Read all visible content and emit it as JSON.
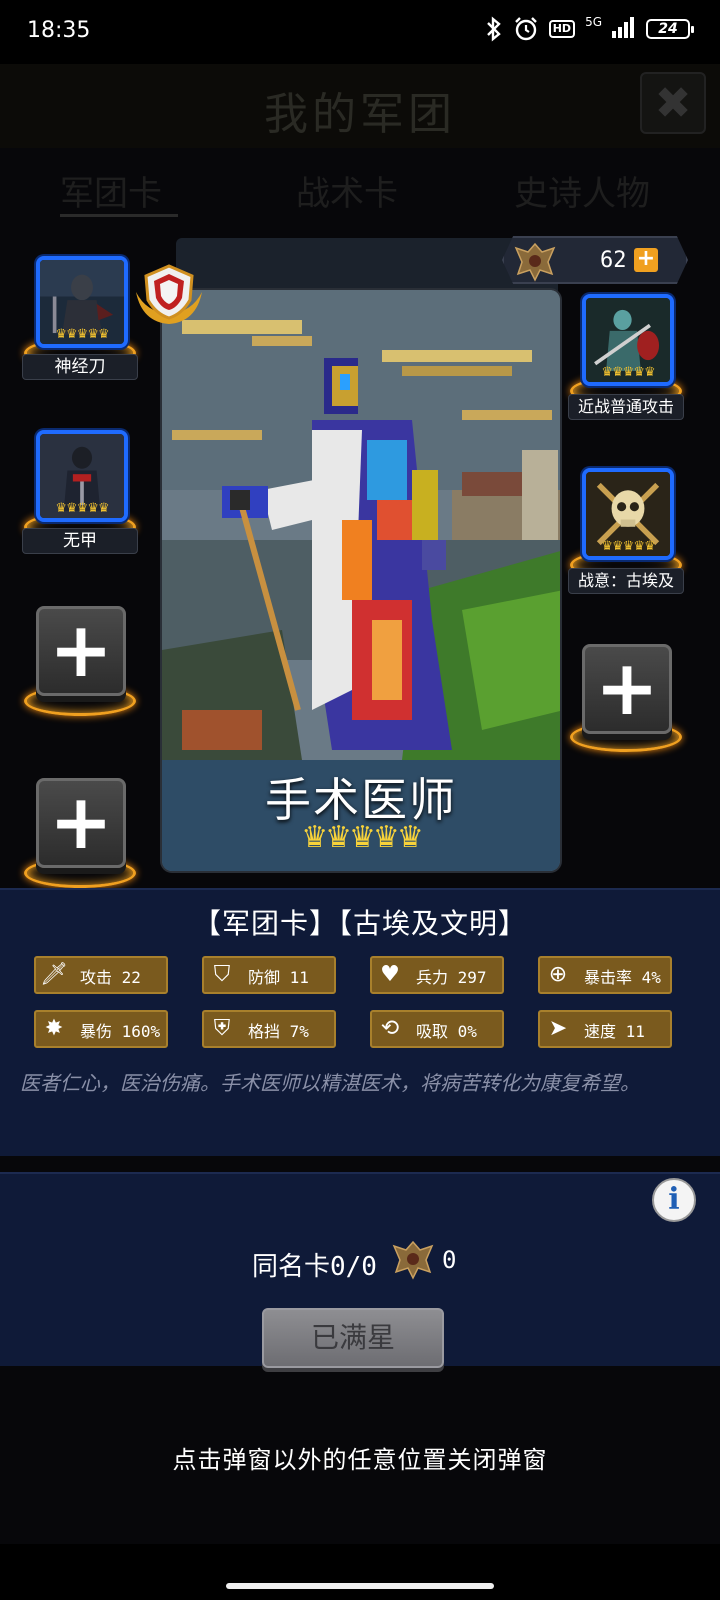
{
  "status_bar": {
    "time": "18:35",
    "network": "5G",
    "hd": "HD",
    "battery": "24"
  },
  "background": {
    "title": "我的军团",
    "tabs": [
      "军团卡",
      "战术卡",
      "史诗人物"
    ]
  },
  "currency": {
    "value": "62"
  },
  "left_slots": [
    {
      "label": "神经刀",
      "stars": 5
    },
    {
      "label": "无甲",
      "stars": 5
    }
  ],
  "right_slots": [
    {
      "label": "近战普通攻击",
      "stars": 5
    },
    {
      "label": "战意：古埃及",
      "stars": 5
    }
  ],
  "card": {
    "name": "手术医师",
    "stars": 5
  },
  "info": {
    "title": "【军团卡】【古埃及文明】",
    "stats": [
      {
        "icon": "sword-icon",
        "label": "攻击 22"
      },
      {
        "icon": "shield-icon",
        "label": "防御 11"
      },
      {
        "icon": "heart-icon",
        "label": "兵力 297"
      },
      {
        "icon": "crosshair-icon",
        "label": "暴击率 4%"
      },
      {
        "icon": "burst-icon",
        "label": "暴伤 160%"
      },
      {
        "icon": "block-icon",
        "label": "格挡 7%"
      },
      {
        "icon": "absorb-icon",
        "label": "吸取 0%"
      },
      {
        "icon": "speed-icon",
        "label": "速度 11"
      }
    ],
    "description": "医者仁心，医治伤痛。手术医师以精湛医术，将病苦转化为康复希望。"
  },
  "duplicates": {
    "text": "同名卡0/0",
    "count": "0",
    "button": "已满星"
  },
  "hint": "点击弹窗以外的任意位置关闭弹窗",
  "colors": {
    "slot_border": "#1f6bff",
    "stat_bg": "#7a5a1e",
    "panel_bg": "#0f1a38",
    "accent_gold": "#f0a020"
  }
}
